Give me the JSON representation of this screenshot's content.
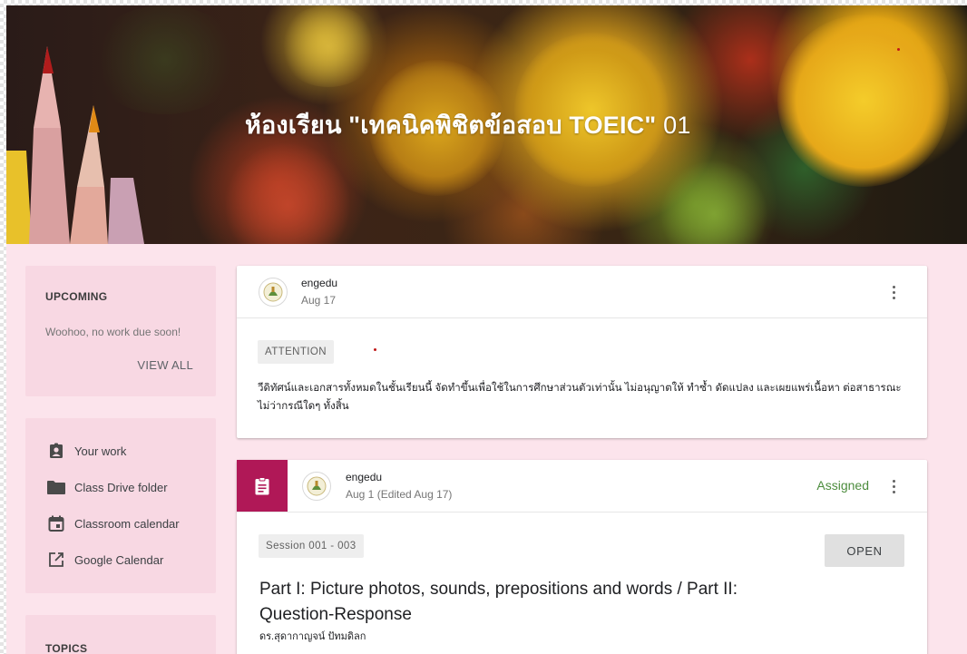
{
  "banner": {
    "title_prefix": "ห้องเรียน \"เทคนิคพิชิตข้อสอบ TOEIC\"",
    "title_suffix": " 01"
  },
  "upcoming": {
    "heading": "UPCOMING",
    "message": "Woohoo, no work due soon!",
    "view_all": "VIEW ALL"
  },
  "links": [
    {
      "label": "Your work",
      "icon": "assignment-ind-icon"
    },
    {
      "label": "Class Drive folder",
      "icon": "folder-icon"
    },
    {
      "label": "Classroom calendar",
      "icon": "calendar-icon"
    },
    {
      "label": "Google Calendar",
      "icon": "open-in-new-icon"
    }
  ],
  "topics": {
    "heading": "TOPICS"
  },
  "announcement": {
    "author": "engedu",
    "date": "Aug 17",
    "chip": "ATTENTION",
    "body": "วีดิทัศน์และเอกสารทั้งหมดในชั้นเรียนนี้ จัดทำขึ้นเพื่อใช้ในการศึกษาส่วนตัวเท่านั้น ไม่อนุญาตให้ ทำซ้ำ ดัดแปลง และเผยแพร่เนื้อหา ต่อสาธารณะ ไม่ว่ากรณีใดๆ ทั้งสิ้น"
  },
  "assignment": {
    "author": "engedu",
    "date": "Aug 1 (Edited Aug 17)",
    "status": "Assigned",
    "chip": "Session 001 - 003",
    "open_label": "OPEN",
    "title": "Part I: Picture photos, sounds, prepositions and words / Part II: Question-Response",
    "subtitle": "ดร.สุดากาญจน์ ปัทมดิลก"
  },
  "colors": {
    "page_bg": "#fce4ec",
    "sidebar_card": "#f8d8e3",
    "assignment_accent": "#b01857",
    "status_green": "#4c8c3d"
  }
}
